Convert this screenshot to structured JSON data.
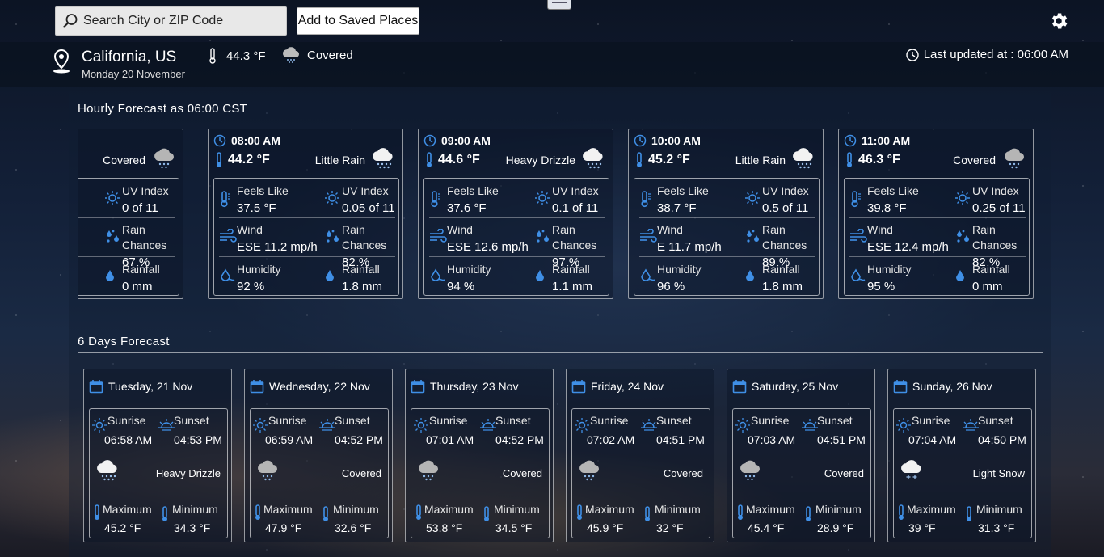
{
  "top": {
    "search_placeholder": "Search City or ZIP Code",
    "add_button": "Add to Saved Places"
  },
  "location": {
    "city": "California, US",
    "date": "Monday 20 November",
    "temp": "44.3 °F",
    "condition": "Covered",
    "last_updated": "Last updated at :  06:00 AM"
  },
  "hourly": {
    "title": "Hourly Forecast as 06:00 CST",
    "labels": {
      "feels": "Feels Like",
      "uv": "UV Index",
      "wind": "Wind",
      "rain_chance": "Rain Chances",
      "humidity": "Humidity",
      "rainfall": "Rainfall"
    },
    "cards": [
      {
        "time": "",
        "temp": "",
        "condition": "Covered",
        "icon": "cloud-rain-icon",
        "feels": "",
        "uv": "0 of 11",
        "wind": "/h",
        "rain_chance": "67 %",
        "humidity": "",
        "rainfall": "0 mm"
      },
      {
        "time": "08:00 AM",
        "temp": "44.2 °F",
        "condition": "Little Rain",
        "icon": "cloud-rain-white-icon",
        "feels": "37.5 °F",
        "uv": "0.05 of 11",
        "wind": "ESE 11.2 mp/h",
        "rain_chance": "82 %",
        "humidity": "92 %",
        "rainfall": "1.8 mm"
      },
      {
        "time": "09:00 AM",
        "temp": "44.6 °F",
        "condition": "Heavy Drizzle",
        "icon": "cloud-rain-white-icon",
        "feels": "37.6 °F",
        "uv": "0.1 of 11",
        "wind": "ESE 12.6 mp/h",
        "rain_chance": "97 %",
        "humidity": "94 %",
        "rainfall": "1.1 mm"
      },
      {
        "time": "10:00 AM",
        "temp": "45.2 °F",
        "condition": "Little Rain",
        "icon": "cloud-rain-white-icon",
        "feels": "38.7 °F",
        "uv": "0.5 of 11",
        "wind": "E 11.7 mp/h",
        "rain_chance": "89 %",
        "humidity": "96 %",
        "rainfall": "1.8 mm"
      },
      {
        "time": "11:00 AM",
        "temp": "46.3 °F",
        "condition": "Covered",
        "icon": "cloud-rain-icon",
        "feels": "39.8 °F",
        "uv": "0.25 of 11",
        "wind": "ESE 12.4 mp/h",
        "rain_chance": "82 %",
        "humidity": "95 %",
        "rainfall": "0 mm"
      }
    ]
  },
  "daily": {
    "title": "6 Days Forecast",
    "labels": {
      "sunrise": "Sunrise",
      "sunset": "Sunset",
      "max": "Maximum",
      "min": "Minimum"
    },
    "days": [
      {
        "day": "Tuesday, 21 Nov",
        "sunrise": "06:58 AM",
        "sunset": "04:53 PM",
        "condition": "Heavy Drizzle",
        "icon": "cloud-rain-white-icon",
        "max": "45.2 °F",
        "min": "34.3 °F"
      },
      {
        "day": "Wednesday, 22 Nov",
        "sunrise": "06:59 AM",
        "sunset": "04:52 PM",
        "condition": "Covered",
        "icon": "cloud-rain-icon",
        "max": "47.9 °F",
        "min": "32.6 °F"
      },
      {
        "day": "Thursday, 23 Nov",
        "sunrise": "07:01 AM",
        "sunset": "04:52 PM",
        "condition": "Covered",
        "icon": "cloud-rain-icon",
        "max": "53.8 °F",
        "min": "34.5 °F"
      },
      {
        "day": "Friday, 24 Nov",
        "sunrise": "07:02 AM",
        "sunset": "04:51 PM",
        "condition": "Covered",
        "icon": "cloud-rain-icon",
        "max": "45.9 °F",
        "min": "32 °F"
      },
      {
        "day": "Saturday, 25 Nov",
        "sunrise": "07:03 AM",
        "sunset": "04:51 PM",
        "condition": "Covered",
        "icon": "cloud-rain-icon",
        "max": "45.4 °F",
        "min": "28.9 °F"
      },
      {
        "day": "Sunday, 26 Nov",
        "sunrise": "07:04 AM",
        "sunset": "04:50 PM",
        "condition": "Light Snow",
        "icon": "cloud-snow-icon",
        "max": "39 °F",
        "min": "31.3 °F"
      }
    ]
  },
  "colors": {
    "accent": "#3f8fe6",
    "panel_border": "#ffffff"
  }
}
